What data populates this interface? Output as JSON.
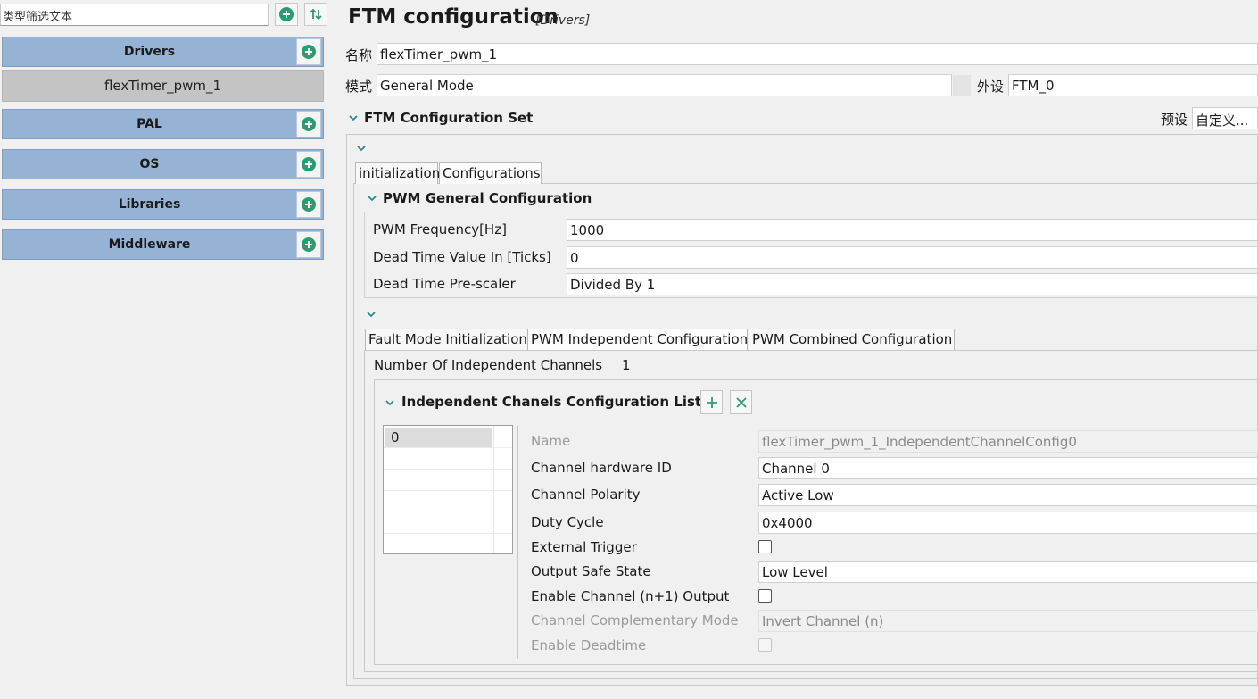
{
  "sidebar": {
    "filter_placeholder": "类型筛选文本",
    "categories": [
      {
        "label": "Drivers",
        "items": [
          "flexTimer_pwm_1"
        ]
      },
      {
        "label": "PAL"
      },
      {
        "label": "OS"
      },
      {
        "label": "Libraries"
      },
      {
        "label": "Middleware"
      }
    ]
  },
  "header": {
    "title": "FTM configuration",
    "subtitle": "[Drivers]"
  },
  "general": {
    "name_label": "名称",
    "name_value": "flexTimer_pwm_1",
    "mode_label": "模式",
    "mode_value": "General Mode",
    "peripheral_label": "外设",
    "peripheral_value": "FTM_0"
  },
  "config_set": {
    "title": "FTM Configuration Set",
    "preset_label": "预设",
    "preset_value": "自定义..."
  },
  "outer_tabs": [
    "initialization",
    "Configurations"
  ],
  "pwm_general": {
    "title": "PWM General Configuration",
    "rows": [
      {
        "label": "PWM Frequency[Hz]",
        "value": "1000"
      },
      {
        "label": "Dead Time Value In [Ticks]",
        "value": "0"
      },
      {
        "label": "Dead Time Pre-scaler",
        "value": "Divided By 1"
      }
    ]
  },
  "inner_tabs": [
    "Fault Mode Initialization",
    "PWM Independent Configuration",
    "PWM Combined Configuration"
  ],
  "independent": {
    "count_label": "Number Of Independent Channels",
    "count_value": "1",
    "list_title": "Independent Chanels Configuration List",
    "list_items": [
      "0"
    ],
    "fields": {
      "name_label": "Name",
      "name_value": "flexTimer_pwm_1_IndependentChannelConfig0",
      "hwid_label": "Channel hardware ID",
      "hwid_value": "Channel 0",
      "polarity_label": "Channel Polarity",
      "polarity_value": "Active Low",
      "duty_label": "Duty Cycle",
      "duty_value": "0x4000",
      "ext_trigger_label": "External Trigger",
      "safe_state_label": "Output Safe State",
      "safe_state_value": "Low Level",
      "enable_n1_label": "Enable Channel (n+1) Output",
      "comp_mode_label": "Channel Complementary Mode",
      "comp_mode_value": "Invert Channel (n)",
      "deadtime_label": "Enable Deadtime"
    }
  },
  "colors": {
    "category_bg": "#96b2d4",
    "selected_item_bg": "#c4c4c4",
    "accent_green": "#2e9a6f",
    "chevron_teal": "#2a8a8a"
  }
}
